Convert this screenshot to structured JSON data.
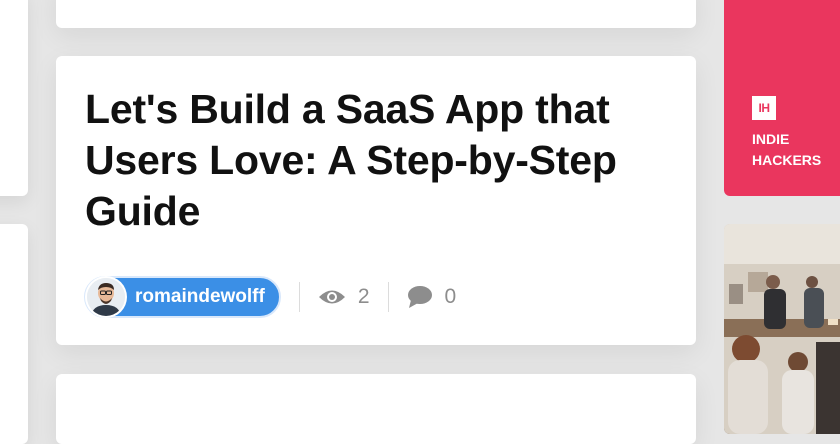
{
  "post": {
    "title": "Let's Build a SaaS App that Users Love: A Step-by-Step Guide",
    "author": "romaindewolff",
    "views": "2",
    "comments": "0"
  },
  "sidebar": {
    "brand_badge": "IH",
    "brand_text": "INDIE HACKERS"
  },
  "icons": {
    "views": "eye-icon",
    "comments": "speech-bubble-icon"
  },
  "colors": {
    "accent": "#3b8fe6",
    "brand": "#ea365e",
    "muted": "#8d8d8d"
  }
}
